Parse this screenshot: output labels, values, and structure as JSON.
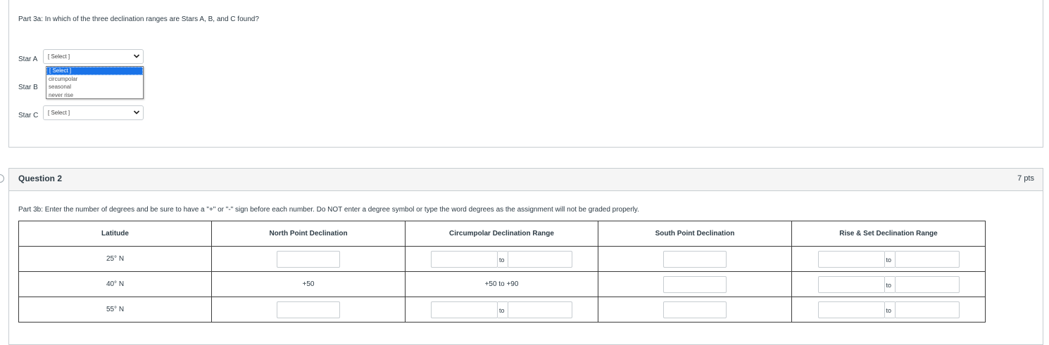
{
  "question1": {
    "prompt": "Part 3a:  In which of the three declination ranges are Stars A, B, and C found?",
    "stars": [
      {
        "label": "Star A",
        "selected": "[ Select ]"
      },
      {
        "label": "Star B",
        "selected": "[ Select ]"
      },
      {
        "label": "Star C",
        "selected": "[ Select ]"
      }
    ],
    "dropdown_options": [
      "[ Select ]",
      "circumpolar",
      "seasonal",
      "never rise"
    ]
  },
  "question2": {
    "title": "Question 2",
    "points": "7 pts",
    "prompt": "Part 3b:  Enter the number of degrees and be sure to have a \"+\" or \"-\" sign before each number.  Do NOT enter a degree symbol or type the word degrees as the assignment will not be graded properly.",
    "table": {
      "headers": [
        "Latitude",
        "North Point Declination",
        "Circumpolar Declination Range",
        "South Point Declination",
        "Rise & Set Declination Range"
      ],
      "range_separator": "to",
      "rows": [
        {
          "latitude": "25° N"
        },
        {
          "latitude": "40° N",
          "north_point": "+50",
          "circumpolar": "+50 to +90"
        },
        {
          "latitude": "55° N"
        }
      ]
    }
  },
  "icons": {
    "chevron": "chevron-down-icon"
  }
}
